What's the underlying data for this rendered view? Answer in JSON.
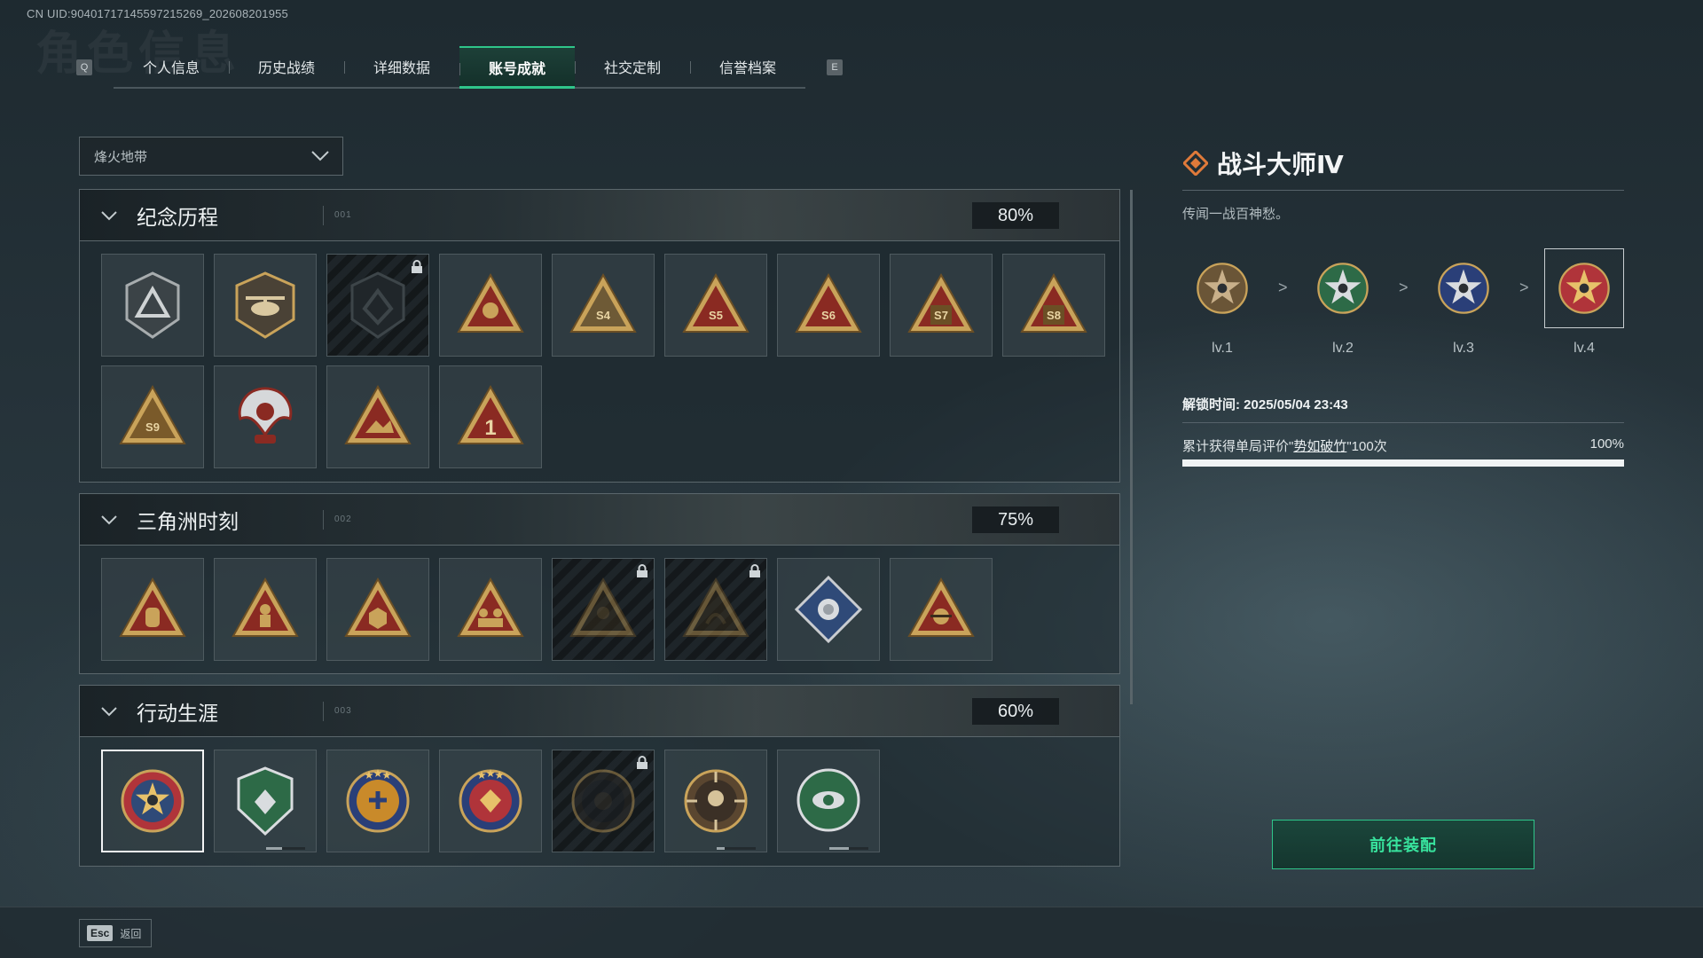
{
  "uid": "CN UID:904017171455972152​69_202608201955",
  "tabs": {
    "left_key": "Q",
    "right_key": "E",
    "items": [
      "个人信息",
      "历史战绩",
      "详细数据",
      "账号成就",
      "社交定制",
      "信誉档案"
    ],
    "active_index": 3
  },
  "filter": {
    "selected": "烽火地带"
  },
  "sections": [
    {
      "title": "纪念历程",
      "code": "001",
      "percent": "80%",
      "badges": [
        {
          "icon": "triangle-shield-badge-icon",
          "locked": false
        },
        {
          "icon": "helicopter-badge-icon",
          "locked": false
        },
        {
          "icon": "dark-shield-badge-icon",
          "locked": true
        },
        {
          "icon": "satellite-dish-badge-icon",
          "locked": false
        },
        {
          "icon": "season-s4-badge-icon",
          "locked": false
        },
        {
          "icon": "season-s5-badge-icon",
          "locked": false
        },
        {
          "icon": "season-s6-badge-icon",
          "locked": false
        },
        {
          "icon": "season-s7-badge-icon",
          "locked": false
        },
        {
          "icon": "season-s8-badge-icon",
          "locked": false
        },
        {
          "icon": "season-s9-badge-icon",
          "locked": false
        },
        {
          "icon": "eagle-s10-badge-icon",
          "locked": false
        },
        {
          "icon": "mountain-badge-icon",
          "locked": false
        },
        {
          "icon": "number-one-badge-icon",
          "locked": false
        }
      ]
    },
    {
      "title": "三角洲时刻",
      "code": "002",
      "percent": "75%",
      "badges": [
        {
          "icon": "capsule-badge-icon",
          "locked": false
        },
        {
          "icon": "soldier-fire-badge-icon",
          "locked": false
        },
        {
          "icon": "hexagon-core-badge-icon",
          "locked": false
        },
        {
          "icon": "squad-badge-icon",
          "locked": false
        },
        {
          "icon": "team-badge-icon",
          "locked": true
        },
        {
          "icon": "serpent-badge-icon",
          "locked": true
        },
        {
          "icon": "rose-diamond-badge-icon",
          "locked": false
        },
        {
          "icon": "skull-crest-badge-icon",
          "locked": false
        }
      ]
    },
    {
      "title": "行动生涯",
      "code": "003",
      "percent": "60%",
      "badges": [
        {
          "icon": "battle-master-badge-icon",
          "locked": false,
          "selected": true
        },
        {
          "icon": "green-shield-badge-icon",
          "locked": false,
          "progress": 0.4
        },
        {
          "icon": "blue-star-crest-badge-icon",
          "locked": false
        },
        {
          "icon": "red-star-crest-badge-icon",
          "locked": false
        },
        {
          "icon": "dark-orb-badge-icon",
          "locked": true
        },
        {
          "icon": "crosshair-skull-badge-icon",
          "locked": false,
          "progress": 0.2
        },
        {
          "icon": "green-eye-badge-icon",
          "locked": false,
          "progress": 0.5
        }
      ]
    }
  ],
  "detail": {
    "title": "战斗大师Ⅳ",
    "description": "传闻一战百神愁。",
    "levels": [
      {
        "label": "lv.1",
        "icon": "bronze-star-medal-icon"
      },
      {
        "label": "lv.2",
        "icon": "green-star-medal-icon"
      },
      {
        "label": "lv.3",
        "icon": "blue-star-medal-icon"
      },
      {
        "label": "lv.4",
        "icon": "gold-star-medal-icon"
      }
    ],
    "current_level_index": 3,
    "arrow": ">",
    "unlock_time": "解锁时间: 2025/05/04 23:43",
    "requirement_prefix": "累计获得单局评价\"",
    "requirement_highlight": "势如破竹",
    "requirement_suffix": "\"100次",
    "progress_text": "100%",
    "progress": 1.0,
    "equip_label": "前往装配"
  },
  "footer": {
    "esc_key": "Esc",
    "esc_label": "返回"
  },
  "colors": {
    "accent": "#2fc58a",
    "gold": "#c9a35a",
    "dark_red": "#8a2a22"
  }
}
